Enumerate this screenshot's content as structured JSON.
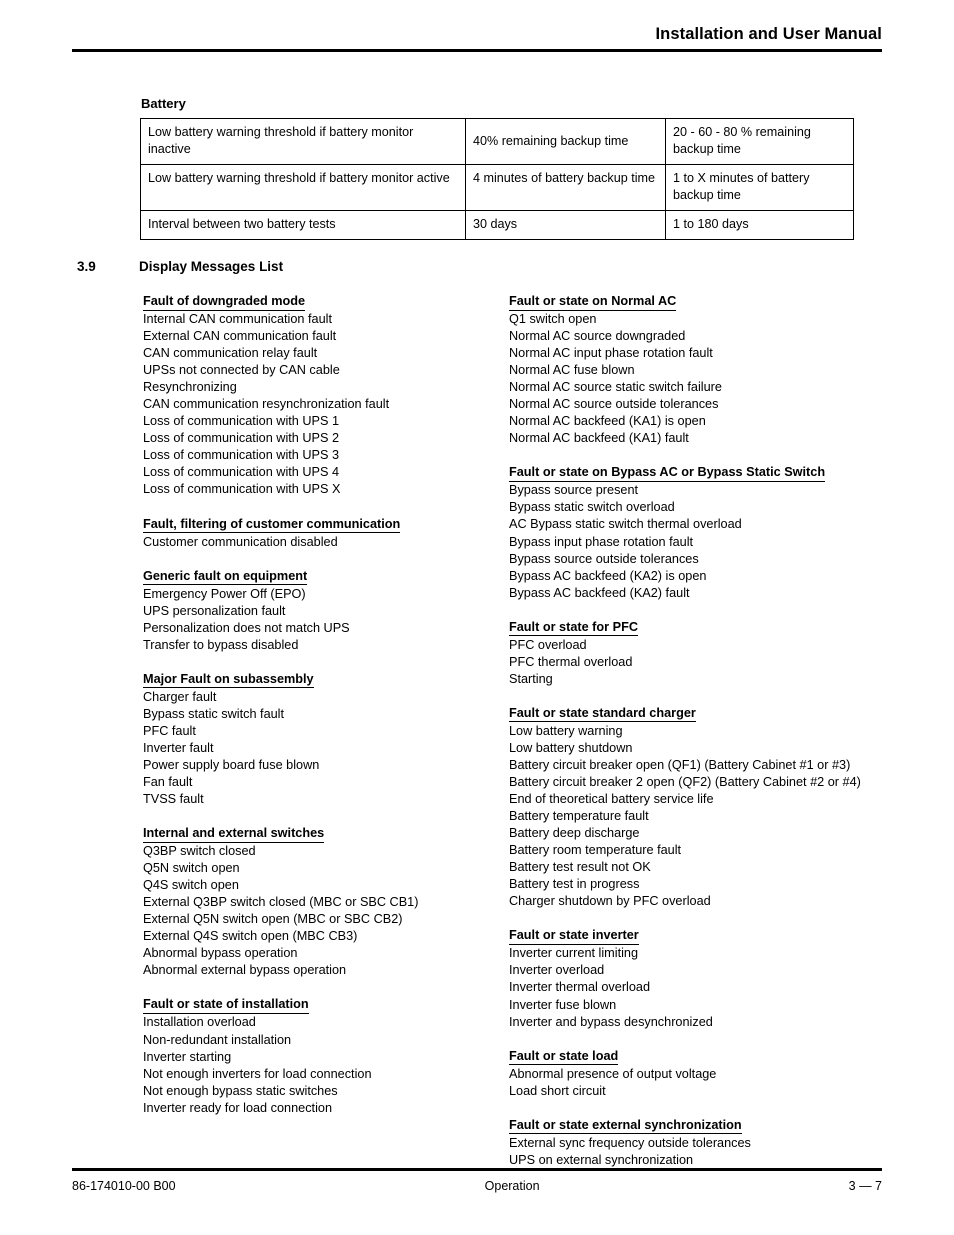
{
  "header": {
    "title": "Installation and User Manual"
  },
  "battery": {
    "label": "Battery",
    "rows": [
      {
        "parameter": "Low battery warning threshold if battery monitor inactive",
        "default": "40% remaining backup time",
        "range": "20 - 60 - 80 % remaining backup time"
      },
      {
        "parameter": "Low battery warning threshold if battery monitor active",
        "default": "4 minutes of battery backup time",
        "range": "1 to X minutes of battery backup time"
      },
      {
        "parameter": "Interval between two battery tests",
        "default": "30 days",
        "range": "1 to 180 days"
      }
    ]
  },
  "section": {
    "number": "3.9",
    "title": "Display Messages List"
  },
  "left_column": [
    {
      "heading": "Fault of downgraded mode",
      "items": [
        "Internal CAN communication fault",
        "External CAN communication fault",
        "CAN communication relay fault",
        "UPSs not connected by CAN cable",
        "Resynchronizing",
        "CAN communication resynchronization fault",
        "Loss of communication with UPS 1",
        "Loss of communication with UPS 2",
        "Loss of communication with UPS 3",
        "Loss of communication with UPS 4",
        "Loss of communication with UPS X"
      ]
    },
    {
      "heading": "Fault, filtering of customer communication",
      "items": [
        "Customer communication disabled"
      ]
    },
    {
      "heading": "Generic fault on equipment",
      "items": [
        "Emergency Power Off (EPO)",
        "UPS personalization fault",
        "Personalization does not match UPS",
        "Transfer to bypass disabled"
      ]
    },
    {
      "heading": "Major Fault on subassembly",
      "items": [
        "Charger fault",
        "Bypass static switch fault",
        "PFC fault",
        "Inverter fault",
        "Power supply board fuse blown",
        "Fan fault",
        "TVSS fault"
      ]
    },
    {
      "heading": "Internal and external switches",
      "items": [
        "Q3BP switch closed",
        "Q5N switch open",
        "Q4S switch open",
        "External Q3BP switch closed (MBC or SBC CB1)",
        "External Q5N switch open (MBC or SBC CB2)",
        "External Q4S switch open (MBC CB3)",
        "Abnormal bypass operation",
        "Abnormal external bypass operation"
      ]
    },
    {
      "heading": "Fault or state of installation",
      "items": [
        "Installation overload",
        "Non-redundant installation",
        "Inverter starting",
        "Not enough inverters for load connection",
        "Not enough bypass static switches",
        "Inverter ready for load connection"
      ]
    }
  ],
  "right_column": [
    {
      "heading": "Fault or state on Normal AC",
      "items": [
        "Q1 switch open",
        "Normal AC source downgraded",
        "Normal AC input phase rotation fault",
        "Normal AC fuse blown",
        "Normal AC source static switch failure",
        "Normal AC source outside tolerances",
        "Normal AC backfeed (KA1) is open",
        "Normal AC backfeed (KA1) fault"
      ]
    },
    {
      "heading": "Fault or state on Bypass AC or Bypass Static Switch",
      "items": [
        "Bypass source present",
        "Bypass static switch overload",
        "AC Bypass static switch thermal overload",
        "Bypass input phase rotation fault",
        "Bypass source outside tolerances",
        "Bypass AC backfeed (KA2) is open",
        "Bypass AC backfeed (KA2) fault"
      ]
    },
    {
      "heading": "Fault or state for PFC",
      "items": [
        "PFC overload",
        "PFC thermal overload",
        "Starting"
      ]
    },
    {
      "heading": "Fault or state standard charger",
      "items": [
        "Low battery warning",
        "Low battery shutdown",
        "Battery circuit breaker open (QF1) (Battery Cabinet #1 or #3)",
        "Battery circuit breaker 2 open (QF2) (Battery Cabinet #2 or #4)",
        "End of theoretical battery service life",
        "Battery temperature fault",
        "Battery deep discharge",
        "Battery room temperature fault",
        "Battery test result not OK",
        "Battery test in progress",
        "Charger shutdown by PFC overload"
      ]
    },
    {
      "heading": "Fault or state inverter",
      "items": [
        "Inverter current limiting",
        "Inverter overload",
        "Inverter thermal overload",
        "Inverter fuse blown",
        "Inverter and bypass desynchronized"
      ]
    },
    {
      "heading": "Fault or state load",
      "items": [
        "Abnormal presence of output voltage",
        "Load short circuit"
      ]
    },
    {
      "heading": "Fault or state external synchronization",
      "items": [
        "External sync frequency outside tolerances",
        "UPS on external synchronization"
      ]
    }
  ],
  "footer": {
    "doc_number": "86-174010-00 B00",
    "chapter": "Operation",
    "page": "3 — 7"
  }
}
